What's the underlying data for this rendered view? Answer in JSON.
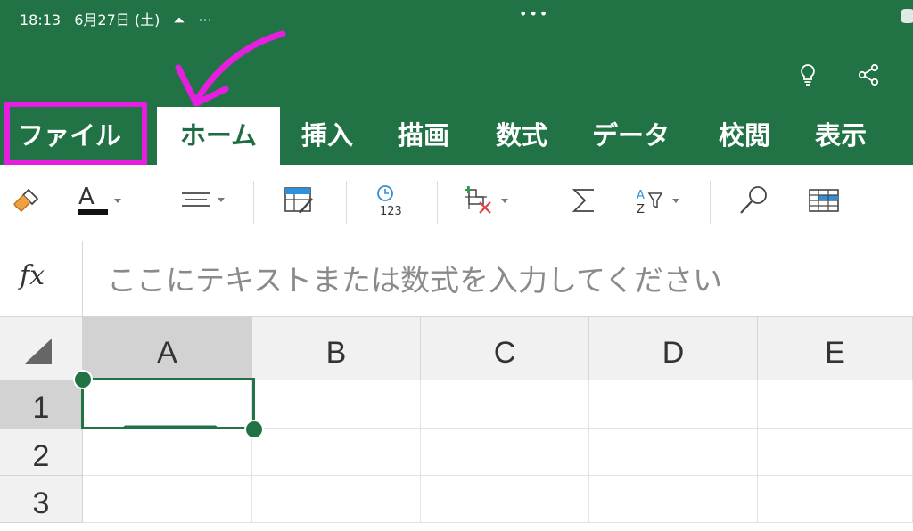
{
  "status_bar": {
    "time": "18:13",
    "date": "6月27日 (土)",
    "more": "···",
    "center_dots": "•••"
  },
  "ribbon": {
    "tabs": [
      {
        "label": "ファイル",
        "active": false
      },
      {
        "label": "ホーム",
        "active": true
      },
      {
        "label": "挿入",
        "active": false
      },
      {
        "label": "描画",
        "active": false
      },
      {
        "label": "数式",
        "active": false
      },
      {
        "label": "データ",
        "active": false
      },
      {
        "label": "校閲",
        "active": false
      },
      {
        "label": "表示",
        "active": false
      }
    ],
    "top_icons": [
      "lightbulb-icon",
      "share-icon"
    ]
  },
  "toolbar": {
    "icons": [
      "format-painter-icon",
      "font-color-icon",
      "align-icon",
      "fill-cell-icon",
      "number-format-icon",
      "clear-icon",
      "autosum-icon",
      "sort-filter-icon",
      "find-icon",
      "table-icon"
    ],
    "font_color_letter": "A",
    "number_format_text": "123",
    "sort_text": "A\nZ"
  },
  "formula_bar": {
    "fx_label": "fx",
    "placeholder": "ここにテキストまたは数式を入力してください"
  },
  "sheet": {
    "columns": [
      "A",
      "B",
      "C",
      "D",
      "E"
    ],
    "rows": [
      "1",
      "2",
      "3"
    ],
    "selected_cell": "A1"
  },
  "annotation": {
    "highlight_color": "#e61ee0"
  },
  "colors": {
    "excel_green": "#217346",
    "accent_blue": "#2f8fd8"
  }
}
